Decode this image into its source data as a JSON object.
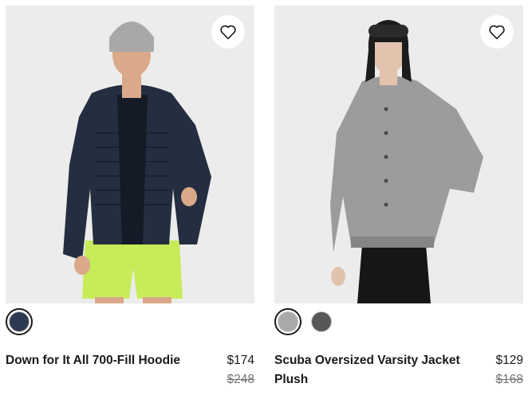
{
  "products": [
    {
      "name": "Down for It All 700-Fill Hoodie",
      "price": "$174",
      "original_price": "$248",
      "image_alt": "Man wearing navy puffer hoodie with lime shorts",
      "swatches": [
        {
          "color": "#2e3a52",
          "selected": true
        }
      ]
    },
    {
      "name": "Scuba Oversized Varsity Jacket Plush",
      "price": "$129",
      "original_price": "$168",
      "image_alt": "Woman wearing grey oversized varsity jacket",
      "swatches": [
        {
          "color": "#a9a9a9",
          "selected": true
        },
        {
          "color": "#555759",
          "selected": false
        }
      ]
    }
  ],
  "colors": {
    "image_bg": "#ececec",
    "text": "#1a1a1a",
    "strike": "#757575"
  },
  "icons": {
    "favorite": "heart-outline-icon"
  }
}
